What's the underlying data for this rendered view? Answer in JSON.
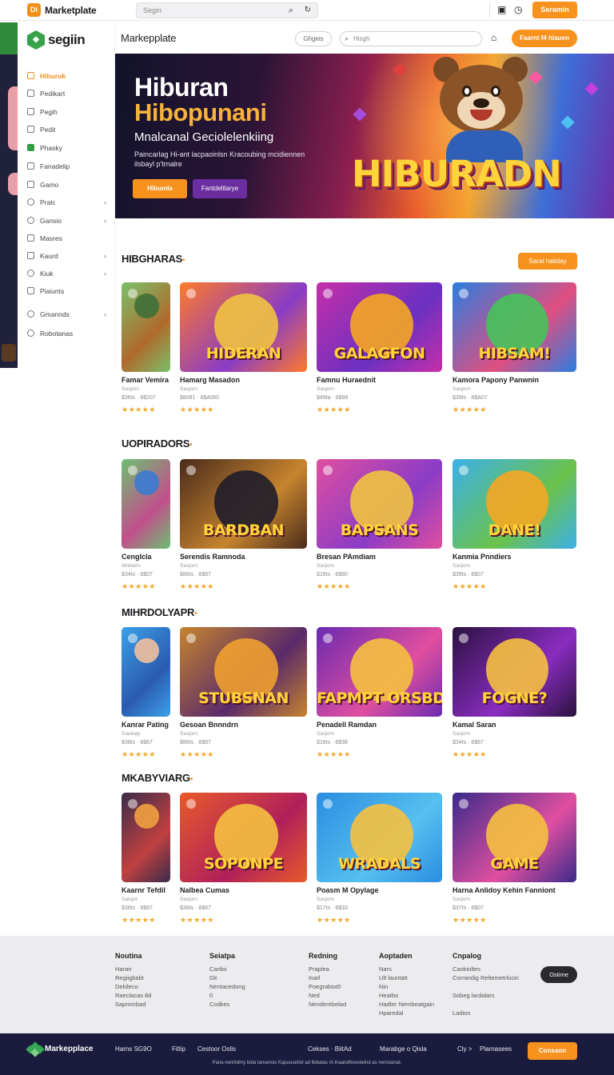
{
  "topbar": {
    "logo_text": "Di",
    "title": "Marketplate",
    "search_placeholder": "Segin",
    "cta_label": "Seramin"
  },
  "sidebar": {
    "brand": "segiin",
    "items": [
      {
        "label": "Hiburuk",
        "icon": "home-icon",
        "active": true,
        "chevron": false
      },
      {
        "label": "Pedikart",
        "icon": "grid-icon",
        "active": false,
        "chevron": false
      },
      {
        "label": "Pegih",
        "icon": "image-icon",
        "active": false,
        "chevron": false
      },
      {
        "label": "Pedit",
        "icon": "image-icon",
        "active": false,
        "chevron": false
      },
      {
        "label": "Phasky",
        "icon": "check-icon",
        "active": false,
        "chevron": false
      },
      {
        "label": "Fanadelip",
        "icon": "file-icon",
        "active": false,
        "chevron": false
      },
      {
        "label": "Gamo",
        "icon": "folder-icon",
        "active": false,
        "chevron": false
      },
      {
        "label": "Pralc",
        "icon": "circle-icon",
        "active": false,
        "chevron": true
      },
      {
        "label": "Gansio",
        "icon": "circle-icon",
        "active": false,
        "chevron": true
      },
      {
        "label": "Masres",
        "icon": "list-icon",
        "active": false,
        "chevron": false
      },
      {
        "label": "Kaurd",
        "icon": "folder-icon",
        "active": false,
        "chevron": true
      },
      {
        "label": "Kiuk",
        "icon": "gear-icon",
        "active": false,
        "chevron": true
      },
      {
        "label": "Piaiunts",
        "icon": "grid-icon",
        "active": false,
        "chevron": false
      },
      {
        "label": "Gmannds",
        "icon": "circle-icon",
        "active": false,
        "chevron": true
      },
      {
        "label": "Robotanas",
        "icon": "circle-icon",
        "active": false,
        "chevron": false
      }
    ]
  },
  "header": {
    "title": "Markepplate",
    "chip": "Ghgeis",
    "search_placeholder": "Hisgh",
    "cta": "Faarnt f4 hlauen"
  },
  "hero": {
    "title_line1": "Hiburan",
    "title_line2": "Hibopunani",
    "subtitle": "Mnalcanal Geciolelenkiing",
    "description": "Paincarlag Hi-ant lacpaoinlsn Kracoubing mcidiennen ilsbayl p'trnalre",
    "button_primary": "Hibumla",
    "button_secondary": "Fantdeltlarye",
    "logo_word": "HIBURADN"
  },
  "sections": [
    {
      "title": "HIBGHARAS",
      "button": "Sarat hatiday",
      "cards": [
        {
          "title": "Famar Vemira",
          "sub": "Sasjorn",
          "price": "$36ts · 8$207",
          "rating": "★★★★★",
          "word": "",
          "scheme": [
            "#7ac06a",
            "#b06a2c",
            "#3f6f3a"
          ]
        },
        {
          "title": "Hamarg Masadon",
          "sub": "Sasjorn",
          "price": "$8081 · 8$4060",
          "rating": "★★★★★",
          "word": "HIDERAN",
          "scheme": [
            "#ff7a2a",
            "#8a3cc6",
            "#f0c340"
          ]
        },
        {
          "title": "Famnu Huraednit",
          "sub": "Sasjorn",
          "price": "$49ta · 8$98",
          "rating": "★★★★★",
          "word": "GALAGFON",
          "scheme": [
            "#c62fa8",
            "#6a30c2",
            "#f5a623"
          ]
        },
        {
          "title": "Kamora Papony Panwnin",
          "sub": "Sasjorn",
          "price": "$39ts · 8$A07",
          "rating": "★★★★★",
          "word": "HIBSAM!",
          "scheme": [
            "#2b7de0",
            "#e04f80",
            "#46c35a"
          ]
        }
      ]
    },
    {
      "title": "UOPIRADORS",
      "button": "",
      "cards": [
        {
          "title": "Cenglcla",
          "sub": "Widaom",
          "price": "$34ts · 8$07",
          "rating": "★★★★★",
          "word": "",
          "scheme": [
            "#6dbf72",
            "#c0508a",
            "#3b7bd1"
          ]
        },
        {
          "title": "Serendis Ramnoda",
          "sub": "Sasjorn",
          "price": "$86ts · 8$87",
          "rating": "★★★★★",
          "word": "BARDBAN",
          "scheme": [
            "#4a2b1c",
            "#c6842e",
            "#1f1d2a"
          ]
        },
        {
          "title": "Bresan PAmdiam",
          "sub": "Sasjorn",
          "price": "$16ts · 8$80",
          "rating": "★★★★★",
          "word": "BAPSANS",
          "scheme": [
            "#e04fa0",
            "#8a3cc6",
            "#f0c340"
          ]
        },
        {
          "title": "Kanmia Pnndiers",
          "sub": "Sasjorn",
          "price": "$39ts · 8$07",
          "rating": "★★★★★",
          "word": "DANE!",
          "scheme": [
            "#3bb0e8",
            "#6cc24a",
            "#f5a623"
          ]
        }
      ]
    },
    {
      "title": "MIHRDOLYAPR",
      "button": "",
      "cards": [
        {
          "title": "Kanrar Pating",
          "sub": "Saeilatp",
          "price": "$38ts · 8$67",
          "rating": "★★★★★",
          "word": "",
          "scheme": [
            "#3ba0e8",
            "#2b5bb0",
            "#f0c0a0"
          ]
        },
        {
          "title": "Gesoan Bnnndrn",
          "sub": "Sasjorn",
          "price": "$86ts · 8$87",
          "rating": "★★★★★",
          "word": "STUBSNAN",
          "scheme": [
            "#c6842e",
            "#5a2a6a",
            "#f0a030"
          ]
        },
        {
          "title": "Penadell Ramdan",
          "sub": "Sasjorn",
          "price": "$16ts · 8$38",
          "rating": "★★★★★",
          "word": "FAPMPT ORSBD",
          "scheme": [
            "#6a2ab0",
            "#e04fa0",
            "#f5c040"
          ]
        },
        {
          "title": "Kamal Saran",
          "sub": "Sasjorn",
          "price": "$34ts · 8$87",
          "rating": "★★★★★",
          "word": "FOGNE?",
          "scheme": [
            "#2a1240",
            "#8a2cc0",
            "#f5c040"
          ]
        }
      ]
    },
    {
      "title": "MKABYVIARG",
      "button": "",
      "cards": [
        {
          "title": "Kaarnr Tefdil",
          "sub": "Salsjol",
          "price": "$38ts · 8$87",
          "rating": "★★★★★",
          "word": "",
          "scheme": [
            "#3a2c4a",
            "#c04040",
            "#f0a040"
          ]
        },
        {
          "title": "Nalbea Cumas",
          "sub": "Sasjorn",
          "price": "$36ts · 8$87",
          "rating": "★★★★★",
          "word": "SOPONPE",
          "scheme": [
            "#e85a2a",
            "#b0205a",
            "#f5c040"
          ]
        },
        {
          "title": "Poasm M Opylage",
          "sub": "Sasjorn",
          "price": "$17ts · 8$33",
          "rating": "★★★★★",
          "word": "WRADALS",
          "scheme": [
            "#2b8de0",
            "#56c0f0",
            "#f5c040"
          ]
        },
        {
          "title": "Harna Anlidoy Kehin Fanniont",
          "sub": "Sasjorn",
          "price": "$37ts · 8$07",
          "rating": "★★★★★",
          "word": "GAME",
          "scheme": [
            "#3a2a8a",
            "#e04fa0",
            "#f5c040"
          ]
        }
      ]
    }
  ],
  "footer": {
    "columns": [
      {
        "heading": "Noutina",
        "links": [
          "Haran",
          "Regiigbabt",
          "Dekileco",
          "Raeclacas Bil",
          "Sapnnnbad"
        ]
      },
      {
        "heading": "Seiatpa",
        "links": [
          "Caribs",
          "Dit",
          "Nentacedong",
          "0",
          "Codkes"
        ]
      },
      {
        "heading": "Redning",
        "links": [
          "Praplea",
          "Inarl",
          "Poegrabiot0",
          "Ned",
          "Nenderebelad"
        ]
      },
      {
        "heading": "Aoptaden",
        "links": [
          "Nars",
          "Ult launtatt",
          "Nin",
          "Heatbo",
          "Hadter Nembeatgain",
          "Hparedal"
        ]
      },
      {
        "heading": "Cnpalog",
        "links": [
          "Caokioltes",
          "Corrandig Reltemetrlocin",
          "",
          "Sobeg lardalars",
          "",
          "Ladion"
        ]
      }
    ],
    "pill": "Ostime"
  },
  "bottombar": {
    "brand": "Markepplace",
    "links": [
      "Harns SG9O",
      "Fitlip",
      "Cestoor Oslis",
      "Cekses · BiitAd",
      "Marabge o Qisla",
      "Cly >",
      "Plarnasees"
    ],
    "button": "Consaon",
    "copyright": "Pana nenrbilmy bida tansenos Kapuusetiot ad lbibalas IA lnaandhowstelnd as nenslaniat."
  },
  "colors": {
    "accent": "#f7921e",
    "brand_green": "#36a34a",
    "footer_bg": "#ececef",
    "bottombar_bg": "#1a1b3d"
  }
}
